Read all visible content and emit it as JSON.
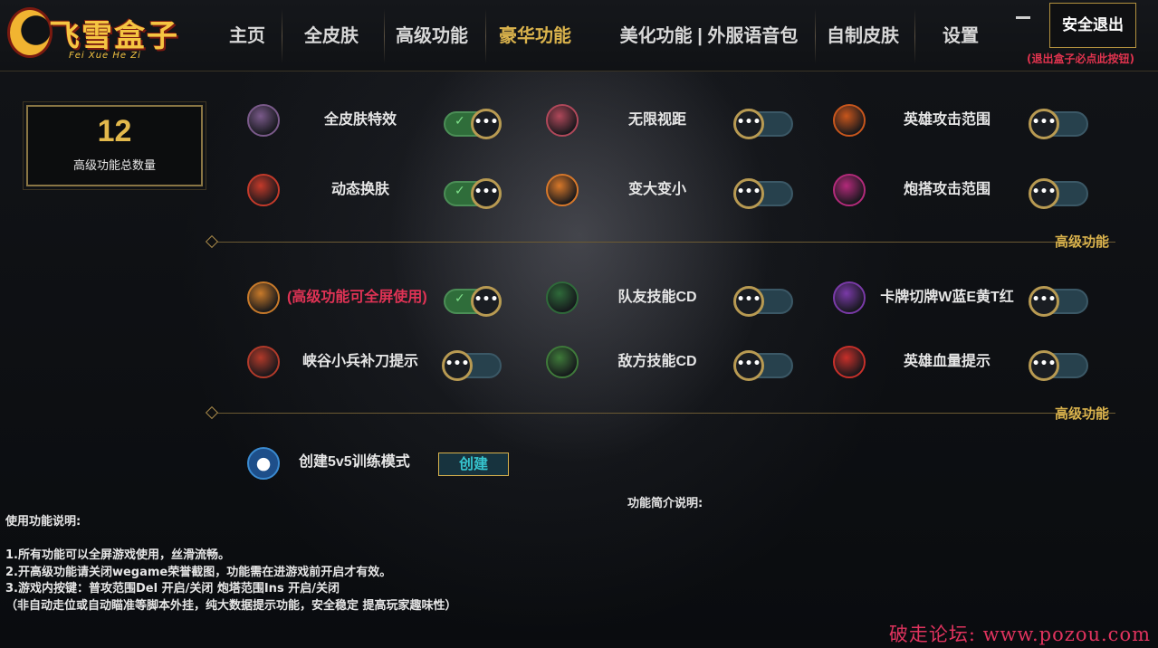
{
  "logo": {
    "main": "飞雪盒子",
    "sub": "Fei Xue He Zi"
  },
  "nav": [
    {
      "label": "主页",
      "active": false
    },
    {
      "label": "全皮肤",
      "active": false
    },
    {
      "label": "高级功能",
      "active": false
    },
    {
      "label": "豪华功能",
      "active": true
    },
    {
      "label": "美化功能 | 外服语音包",
      "active": false
    },
    {
      "label": "自制皮肤",
      "active": false
    },
    {
      "label": "设置",
      "active": false
    }
  ],
  "window": {
    "minimize": "—",
    "logout_label": "安全退出",
    "logout_hint": "(退出盒子必点此按钮)"
  },
  "stat": {
    "count": "12",
    "label": "高级功能总数量"
  },
  "features": [
    {
      "label": "全皮肤特效",
      "on": true,
      "icon": "elephant-mech-icon",
      "color": "#7a5a8a"
    },
    {
      "label": "无限视距",
      "on": false,
      "icon": "rhino-icon",
      "color": "#b0485a"
    },
    {
      "label": "英雄攻击范围",
      "on": false,
      "icon": "golem-icon",
      "color": "#c8561c"
    },
    {
      "label": "动态换肤",
      "on": true,
      "icon": "boar-icon",
      "color": "#c43a2a"
    },
    {
      "label": "变大变小",
      "on": false,
      "icon": "dragon-icon",
      "color": "#d8782a"
    },
    {
      "label": "炮搭攻击范围",
      "on": false,
      "icon": "spiked-warrior-icon",
      "color": "#b32a7a"
    },
    {
      "label": "(高级功能可全屏使用)",
      "on": true,
      "icon": "winged-helmet-icon",
      "color": "#c87a2a",
      "red": true
    },
    {
      "label": "队友技能CD",
      "on": false,
      "icon": "panda-icon",
      "color": "#2f6a3a"
    },
    {
      "label": "卡牌切牌W蓝E黄T红",
      "on": false,
      "icon": "purple-beast-icon",
      "color": "#7a3aa8"
    },
    {
      "label": "峡谷小兵补刀提示",
      "on": false,
      "icon": "hooded-figure-icon",
      "color": "#b23a2a"
    },
    {
      "label": "敌方技能CD",
      "on": false,
      "icon": "green-ogre-icon",
      "color": "#3f7a3a"
    },
    {
      "label": "英雄血量提示",
      "on": false,
      "icon": "phoenix-icon",
      "color": "#c8302a"
    }
  ],
  "sections": [
    "高级功能",
    "高级功能"
  ],
  "training": {
    "label": "创建5v5训练模式",
    "button": "创建",
    "icon": "bomb-mascot-icon"
  },
  "intro_title": "功能简介说明:",
  "usage": [
    "使用功能说明:",
    "",
    "1.所有功能可以全屏游戏使用，丝滑流畅。",
    "2.开高级功能请关闭wegame荣誉截图，功能需在进游戏前开启才有效。",
    "3.游戏内按键：普攻范围Del 开启/关闭   炮塔范围Ins 开启/关闭",
    "（非自动走位或自动瞄准等脚本外挂，纯大数据提示功能，安全稳定 提高玩家趣味性）"
  ],
  "toggle_knob": "•••",
  "toggle_check": "✓",
  "watermark": "破走论坛: www.pozou.com"
}
